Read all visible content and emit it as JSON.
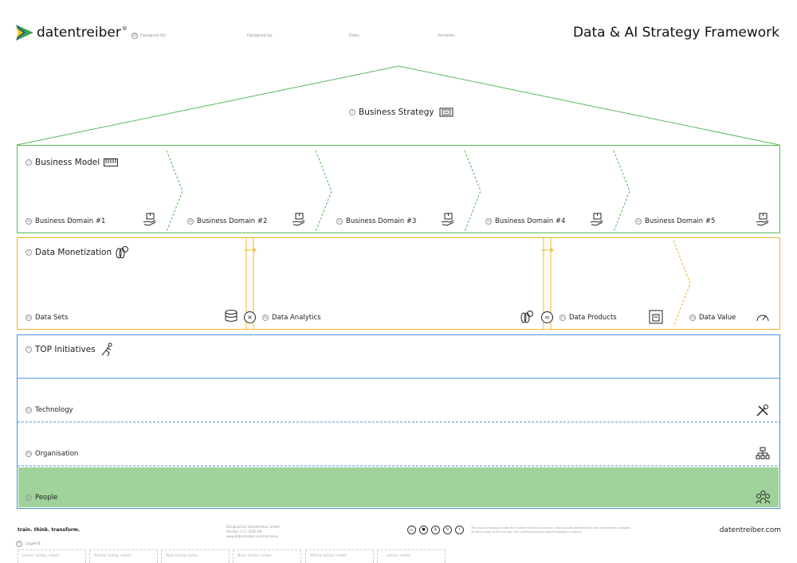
{
  "header": {
    "logo_text": "datentreiber",
    "logo_mark": "®",
    "step_number": "00",
    "fields": [
      {
        "label": "Designed for:"
      },
      {
        "label": "Designed by:"
      },
      {
        "label": "Date:"
      },
      {
        "label": "Iteration:"
      }
    ],
    "page_title": "Data & AI Strategy Framework"
  },
  "roof": {
    "number": "2",
    "label": "Business Strategy",
    "icon": "strategy-board-icon"
  },
  "business_model": {
    "number": "3",
    "title": "Business Model",
    "icon": "keyboard-icon",
    "domains": [
      {
        "number": "3a",
        "label": "Business Domain #1",
        "icon": "hand-box-icon"
      },
      {
        "number": "3b",
        "label": "Business Domain #2",
        "icon": "hand-box-icon"
      },
      {
        "number": "3c",
        "label": "Business Domain #3",
        "icon": "hand-box-icon"
      },
      {
        "number": "3d",
        "label": "Business Domain #4",
        "icon": "hand-box-icon"
      },
      {
        "number": "3e",
        "label": "Business Domain #5",
        "icon": "hand-box-icon"
      }
    ],
    "color": "#5cb85c"
  },
  "data_monetization": {
    "number": "4",
    "title": "Data Monetization",
    "icon": "coins-icon",
    "stages": [
      {
        "number": "4a",
        "label": "Data Sets",
        "icon": "database-icon"
      },
      {
        "number": "4b",
        "label": "Data Analytics",
        "icon": "coins-icon"
      },
      {
        "number": "4c",
        "label": "Data Products",
        "icon": "printer-icon"
      },
      {
        "number": "4d",
        "label": "Data Value",
        "icon": "gauge-icon"
      }
    ],
    "operators": [
      "×",
      "="
    ],
    "arrow": "→",
    "color": "#f0b429"
  },
  "top_initiatives": {
    "number": "5",
    "title": "TOP Initiatives",
    "icon": "runner-icon",
    "rows": [
      {
        "number": "5a",
        "label": "Technology",
        "icon": "tools-icon"
      },
      {
        "number": "5b",
        "label": "Organisation",
        "icon": "org-chart-icon"
      },
      {
        "number": "5c",
        "label": "People",
        "icon": "people-icon"
      }
    ],
    "color": "#4a90d9",
    "people_fill": "#9fd39b"
  },
  "footer": {
    "tagline": "train. think. transform.",
    "design_credit": [
      "Designed by: Datentreiber GmbH",
      "Version: 1.1 / 2025 EN",
      "www.datentreiber.com/canvases"
    ],
    "license_icons": [
      "cc-icon",
      "by-icon",
      "nc-icon",
      "sa-icon",
      "info-icon"
    ],
    "license_text": [
      "This work is licensed under the Creative Commons License. Sharing with attribution for non-commercial purposes.",
      "To view a copy of this license, visit creativecommons.org/licenses/by-nc-sa/4.0/"
    ],
    "site": "datentreiber.com"
  },
  "legend": {
    "number": "0",
    "label": "Legend:",
    "stickies": [
      "Green sticky notes",
      "Yellow sticky notes",
      "Red sticky notes",
      "Blue sticky notes",
      "White sticky notes",
      "... sticky notes"
    ]
  }
}
